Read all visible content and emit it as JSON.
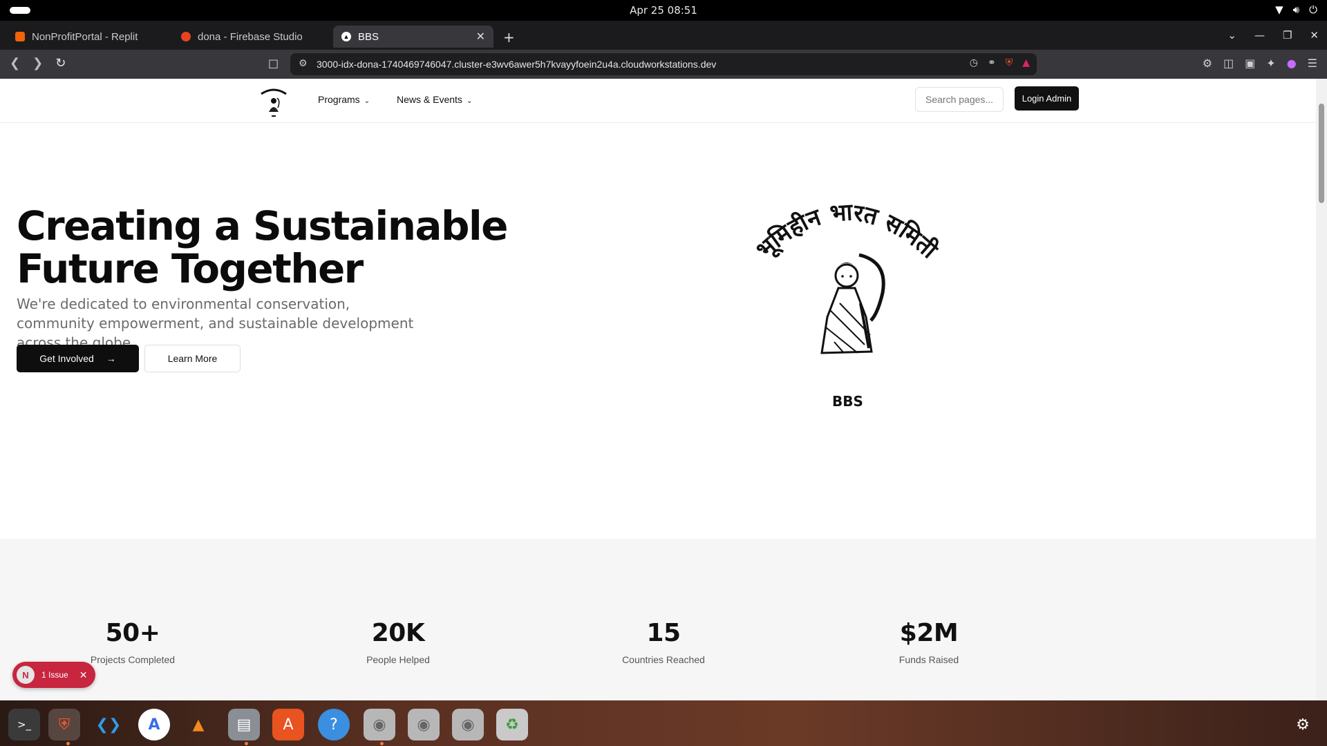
{
  "os": {
    "clock": "Apr 25  08:51",
    "tray_icons": [
      "wifi-icon",
      "volume-icon",
      "power-icon"
    ]
  },
  "browser": {
    "tabs": [
      {
        "title": "NonProfitPortal - Replit",
        "favicon": "replit-icon",
        "active": false
      },
      {
        "title": "dona - Firebase Studio",
        "favicon": "firebase-icon",
        "active": false
      },
      {
        "title": "BBS",
        "favicon": "triangle-icon",
        "active": true
      }
    ],
    "new_tab": "+",
    "url": "3000-idx-dona-1740469746047.cluster-e3wv6awer5h7kvayyfoein2u4a.cloudworkstations.dev",
    "window_controls": [
      "chevron-down-icon",
      "minimize-icon",
      "restore-icon",
      "close-icon"
    ]
  },
  "site": {
    "menu": [
      "Programs",
      "News & Events"
    ],
    "search_placeholder": "Search pages...",
    "login_label": "Login Admin",
    "hero": {
      "title": "Creating a Sustainable Future Together",
      "subtitle": "We're dedicated to environmental conservation, community empowerment, and sustainable development across the globe.",
      "primary_cta": "Get Involved",
      "secondary_cta": "Learn More"
    },
    "logo": {
      "devanagari_text": "भूमिहीन भारत समिती",
      "caption": "BBS"
    },
    "stats": [
      {
        "value": "50+",
        "label": "Projects Completed"
      },
      {
        "value": "20K",
        "label": "People Helped"
      },
      {
        "value": "15",
        "label": "Countries Reached"
      },
      {
        "value": "$2M",
        "label": "Funds Raised"
      }
    ],
    "issue_badge": {
      "avatar": "N",
      "label": "1 Issue"
    }
  },
  "dock": {
    "apps": [
      "terminal-icon",
      "brave-icon",
      "vscode-icon",
      "android-studio-icon",
      "vlc-icon",
      "files-icon",
      "app-center-icon",
      "help-icon",
      "disc-icon",
      "disc-icon",
      "disc-icon",
      "trash-icon"
    ]
  }
}
